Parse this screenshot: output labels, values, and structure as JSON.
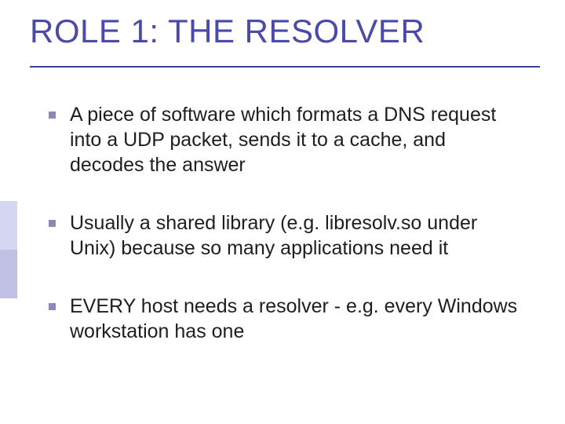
{
  "slide": {
    "title": "ROLE 1: THE RESOLVER",
    "bullets": [
      {
        "text": "A piece of software which formats a DNS request into a UDP packet, sends it to a cache, and decodes the answer"
      },
      {
        "text": "Usually a shared library (e.g. libresolv.so under Unix) because so many applications need it"
      },
      {
        "text": "EVERY host needs a resolver - e.g. every Windows workstation has one"
      }
    ]
  },
  "colors": {
    "title_color": "#4a4aa8",
    "rule_color": "#3e3e93",
    "bullet_color": "#8a8ab8",
    "accent_light": "#d6d6f0",
    "accent_mid": "#c1c1e6"
  }
}
